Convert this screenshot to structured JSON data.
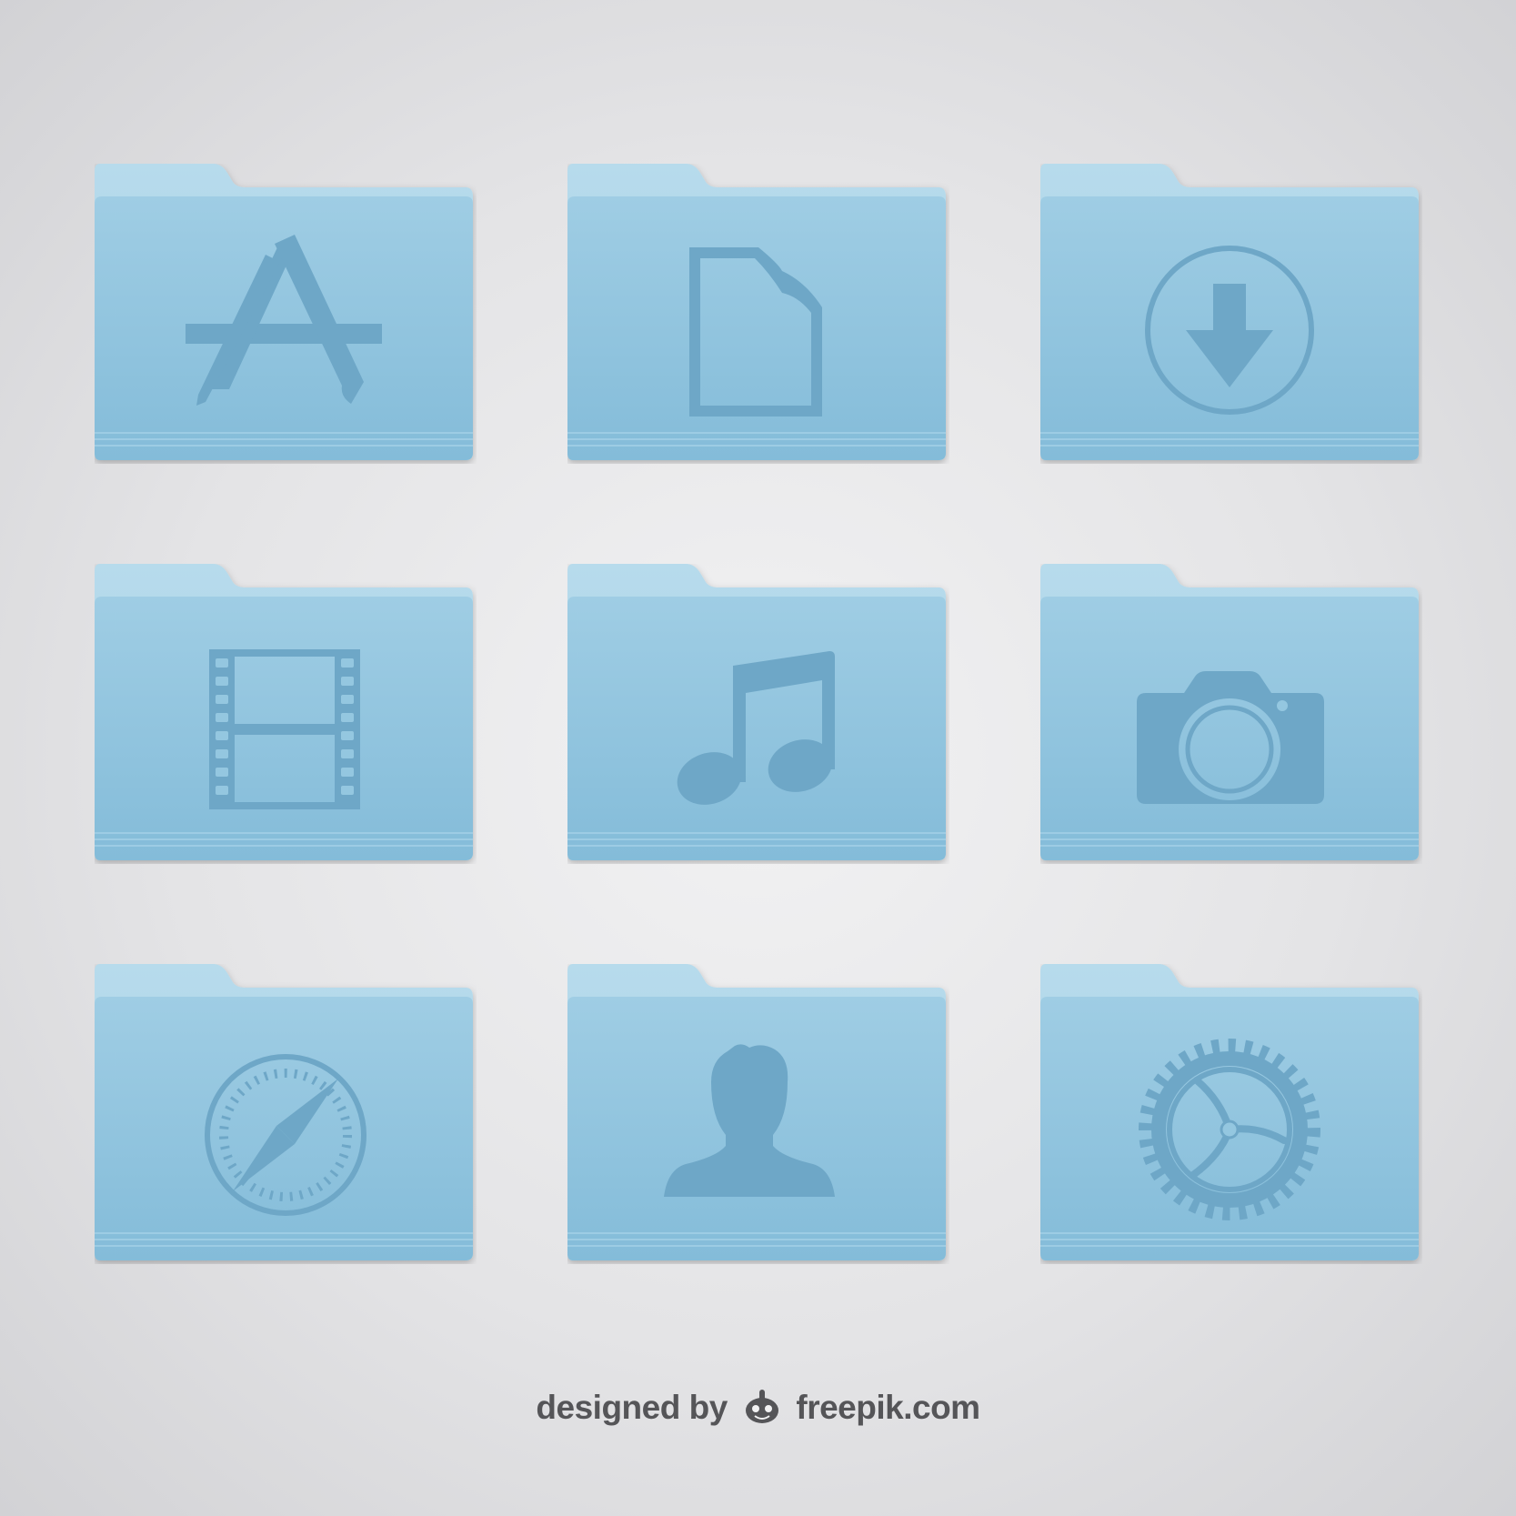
{
  "folders": [
    {
      "name": "applications-folder",
      "icon": "app-store-icon"
    },
    {
      "name": "documents-folder",
      "icon": "document-icon"
    },
    {
      "name": "downloads-folder",
      "icon": "download-arrow-icon"
    },
    {
      "name": "movies-folder",
      "icon": "film-strip-icon"
    },
    {
      "name": "music-folder",
      "icon": "music-note-icon"
    },
    {
      "name": "pictures-folder",
      "icon": "camera-icon"
    },
    {
      "name": "safari-folder",
      "icon": "compass-icon"
    },
    {
      "name": "user-folder",
      "icon": "user-silhouette-icon"
    },
    {
      "name": "settings-folder",
      "icon": "gear-icon"
    }
  ],
  "footer": {
    "prefix": "designed by",
    "brand": "freepik.com"
  },
  "colors": {
    "folder_body": "#8ec3dd",
    "folder_tab": "#a9d3e7",
    "glyph": "#6ea7c7",
    "footer_text": "#555558"
  }
}
